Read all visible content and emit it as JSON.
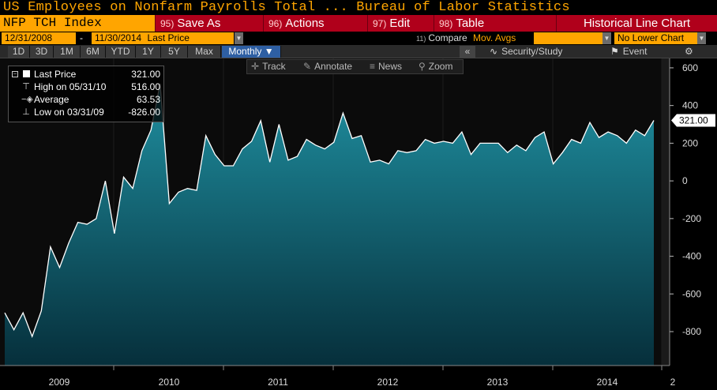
{
  "header": {
    "title": "US Employees on Nonfarm Payrolls Total ... Bureau of Labor Statistics",
    "ticker": "NFP TCH Index",
    "menu": [
      {
        "num": "95)",
        "label": "Save As"
      },
      {
        "num": "96)",
        "label": "Actions"
      },
      {
        "num": "97)",
        "label": "Edit"
      },
      {
        "num": "98)",
        "label": "Table"
      }
    ],
    "chart_type_label": "Historical Line Chart"
  },
  "dates": {
    "start": "12/31/2008",
    "separator": "-",
    "end": "11/30/2014",
    "price_field": "Last Price",
    "compare_num": "11)",
    "compare_label": "Compare",
    "mavg_label": "Mov. Avgs",
    "lower_chart": "No Lower Chart"
  },
  "toolbar": {
    "ranges": [
      "1D",
      "3D",
      "1M",
      "6M",
      "YTD",
      "1Y",
      "5Y",
      "Max"
    ],
    "period": "Monthly ▼",
    "collapse": "«",
    "security_study": "Security/Study",
    "event": "Event",
    "gear": "⚙"
  },
  "subtools": {
    "track": "Track",
    "annotate": "Annotate",
    "news": "News",
    "zoom": "Zoom"
  },
  "legend": {
    "minus": "−",
    "last_label": "Last Price",
    "last_value": "321.00",
    "high_label": "High on 05/31/10",
    "high_value": "516.00",
    "avg_label": "Average",
    "avg_value": "63.53",
    "low_label": "Low on 03/31/09",
    "low_value": "-826.00"
  },
  "colors": {
    "accent": "#ffa500",
    "menu_red": "#b0001b",
    "fill_top": "#1f8fa0",
    "fill_bottom": "#062f3b"
  },
  "chart_data": {
    "type": "area",
    "title": "US Employees on Nonfarm Payrolls Total ... Bureau of Labor Statistics",
    "ylim": [
      -980,
      650
    ],
    "y_ticks": [
      600,
      400,
      200,
      0,
      -200,
      -400,
      -600,
      -800
    ],
    "x_ticks": [
      "2009",
      "2010",
      "2011",
      "2012",
      "2013",
      "2014",
      "2"
    ],
    "last_value_label": "321.00",
    "series": [
      {
        "values": [
          -700,
          -790,
          -700,
          -826,
          -690,
          -350,
          -460,
          -330,
          -220,
          -230,
          -200,
          0,
          -280,
          20,
          -40,
          160,
          270,
          516,
          -120,
          -60,
          -40,
          -50,
          240,
          140,
          80,
          80,
          170,
          210,
          320,
          100,
          300,
          110,
          130,
          220,
          190,
          170,
          205,
          360,
          225,
          240,
          100,
          110,
          90,
          160,
          150,
          160,
          220,
          200,
          210,
          200,
          260,
          140,
          200,
          200,
          200,
          150,
          190,
          160,
          230,
          260,
          90,
          150,
          220,
          200,
          310,
          230,
          260,
          240,
          200,
          270,
          240,
          321
        ]
      }
    ]
  }
}
